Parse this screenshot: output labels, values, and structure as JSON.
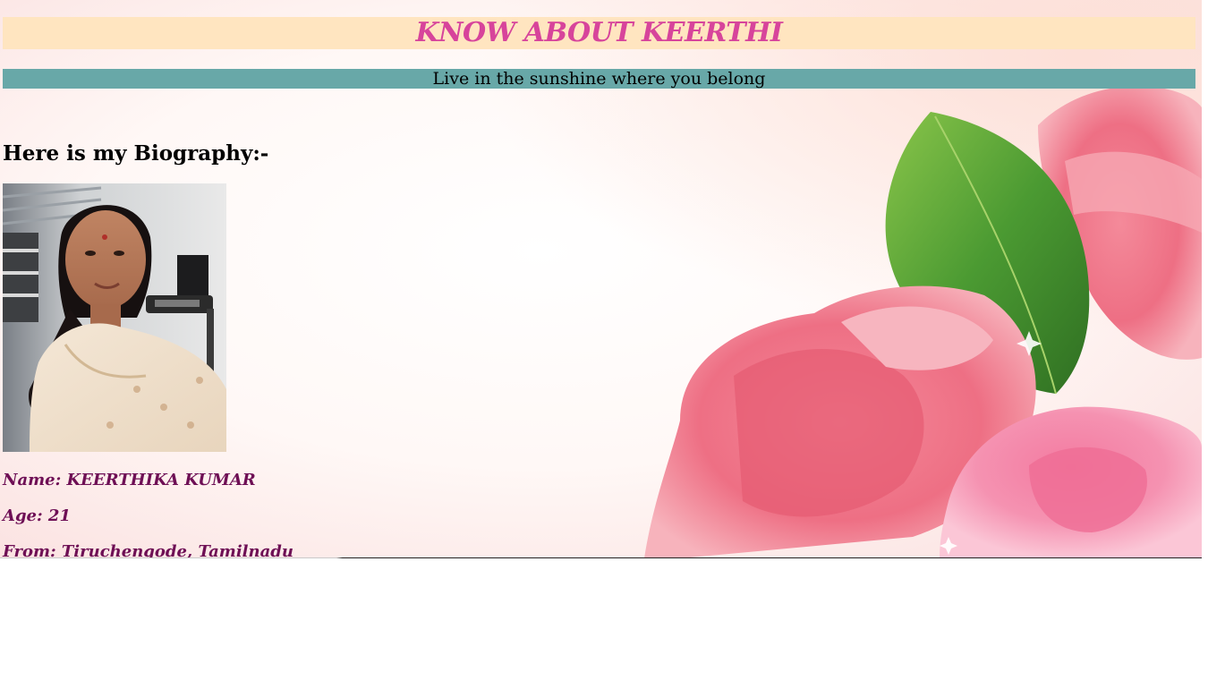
{
  "header": {
    "title": "KNOW ABOUT KEERTHI",
    "tagline": "Live in the sunshine where you belong"
  },
  "biography": {
    "heading": "Here is my Biography:-",
    "photo_icon": "portrait-photo",
    "details": {
      "name": "Name: KEERTHIKA KUMAR",
      "age": "Age: 21",
      "from": "From: Tiruchengode, Tamilnadu"
    }
  },
  "background": {
    "image": "pink-roses-illustration"
  },
  "colors": {
    "title_text": "#d7449b",
    "title_bg": "#ffe5c0",
    "tagline_bg": "#68a8a8",
    "detail_text": "#6e0f55"
  }
}
